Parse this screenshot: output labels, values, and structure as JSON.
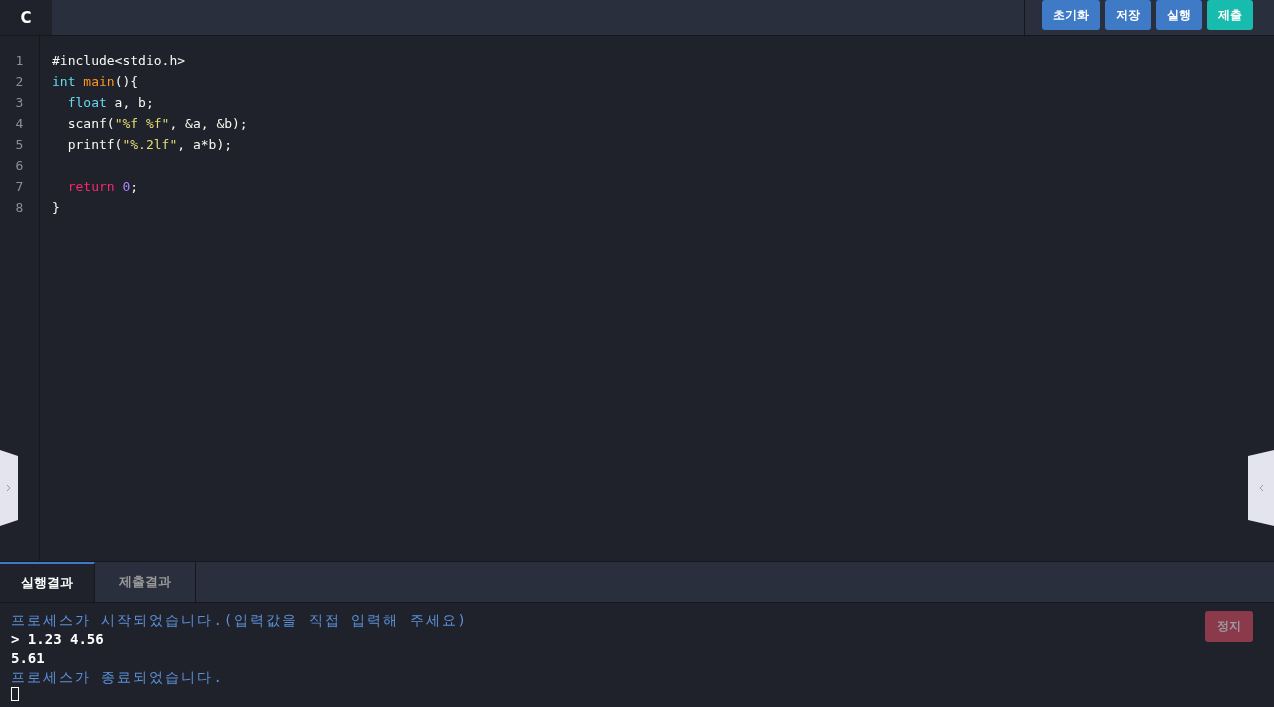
{
  "language_tab": {
    "label": "C",
    "selected": true
  },
  "toolbar_buttons": [
    {
      "label": "초기화",
      "kind": "normal"
    },
    {
      "label": "저장",
      "kind": "normal"
    },
    {
      "label": "실행",
      "kind": "normal"
    },
    {
      "label": "제출",
      "kind": "primary"
    }
  ],
  "code_lines": [
    {
      "number": "1",
      "tokens": [
        {
          "text": "#include<stdio.h>",
          "kind": "plain"
        }
      ]
    },
    {
      "number": "2",
      "tokens": [
        {
          "text": "int",
          "kind": "type"
        },
        {
          "text": " main",
          "kind": "function"
        },
        {
          "text": "(){",
          "kind": "plain"
        }
      ]
    },
    {
      "number": "3",
      "tokens": [
        {
          "text": "  float",
          "kind": "type"
        },
        {
          "text": " a, b;",
          "kind": "plain"
        }
      ]
    },
    {
      "number": "4",
      "tokens": [
        {
          "text": "  scanf(",
          "kind": "plain"
        },
        {
          "text": "\"%f %f\"",
          "kind": "string"
        },
        {
          "text": ", &a, &b);",
          "kind": "plain"
        }
      ]
    },
    {
      "number": "5",
      "tokens": [
        {
          "text": "  printf(",
          "kind": "plain"
        },
        {
          "text": "\"%.2lf\"",
          "kind": "string"
        },
        {
          "text": ", a*b);",
          "kind": "plain"
        }
      ]
    },
    {
      "number": "6"
    },
    {
      "number": "7",
      "tokens": [
        {
          "text": "  return",
          "kind": "keyword"
        },
        {
          "text": " 0",
          "kind": "number"
        },
        {
          "text": ";",
          "kind": "plain"
        }
      ]
    },
    {
      "number": "8",
      "tokens": [
        {
          "text": "}",
          "kind": "plain"
        }
      ]
    }
  ],
  "result_tabs": [
    {
      "label": "실행결과",
      "selected": true
    },
    {
      "label": "제출결과",
      "selected": false
    }
  ],
  "stop_button": {
    "label": "정지",
    "disabled": true
  },
  "console_lines": [
    {
      "text": "프로세스가 시작되었습니다.(입력값을 직접 입력해 주세요)",
      "kind": "system"
    },
    {
      "text": "> 1.23 4.56",
      "kind": "output"
    },
    {
      "text": "5.61",
      "kind": "output"
    },
    {
      "text": "프로세스가 종료되었습니다.",
      "kind": "system"
    }
  ]
}
